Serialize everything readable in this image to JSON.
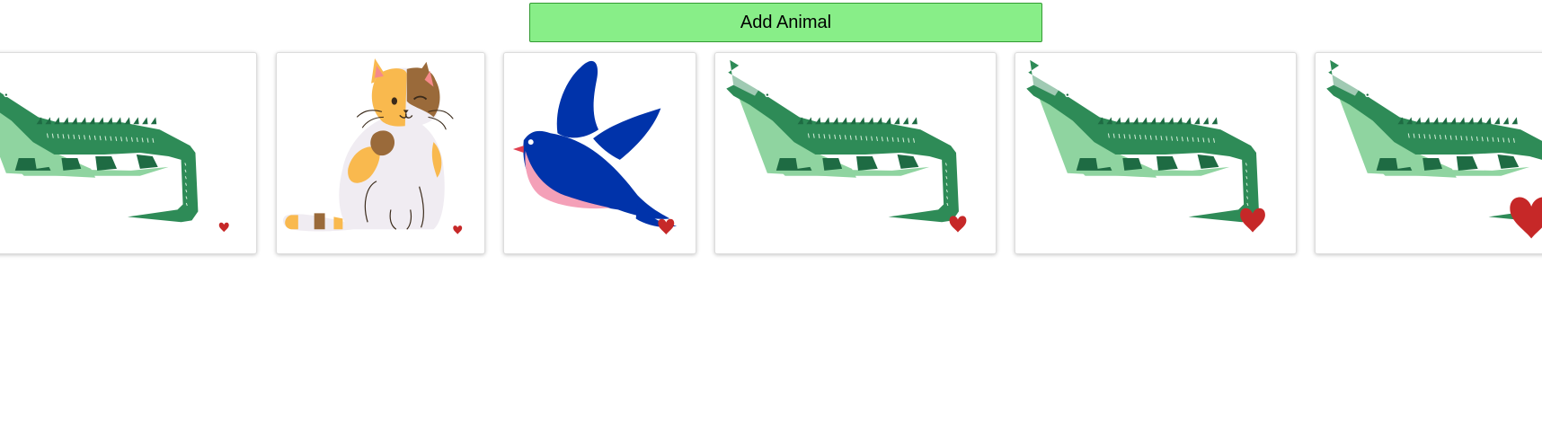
{
  "add_button": {
    "label": "Add Animal"
  },
  "animals": [
    {
      "kind": "crocodile",
      "icon": "crocodile-icon",
      "liked": true,
      "heart_level": 1
    },
    {
      "kind": "cat",
      "icon": "cat-icon",
      "liked": true,
      "heart_level": 1
    },
    {
      "kind": "bird",
      "icon": "bird-icon",
      "liked": true,
      "heart_level": 2
    },
    {
      "kind": "crocodile",
      "icon": "crocodile-icon",
      "liked": true,
      "heart_level": 2
    },
    {
      "kind": "crocodile",
      "icon": "crocodile-icon",
      "liked": true,
      "heart_level": 3
    },
    {
      "kind": "crocodile",
      "icon": "crocodile-icon",
      "liked": true,
      "heart_level": 4
    }
  ],
  "colors": {
    "button_bg": "#88ee88",
    "heart": "#c62828",
    "croc_dark": "#2e8b57",
    "croc_light": "#8fd4a0",
    "bird_blue": "#0033aa",
    "bird_pink": "#f4a0b8",
    "cat_orange": "#f9b94e",
    "cat_brown": "#9a6a3a"
  }
}
